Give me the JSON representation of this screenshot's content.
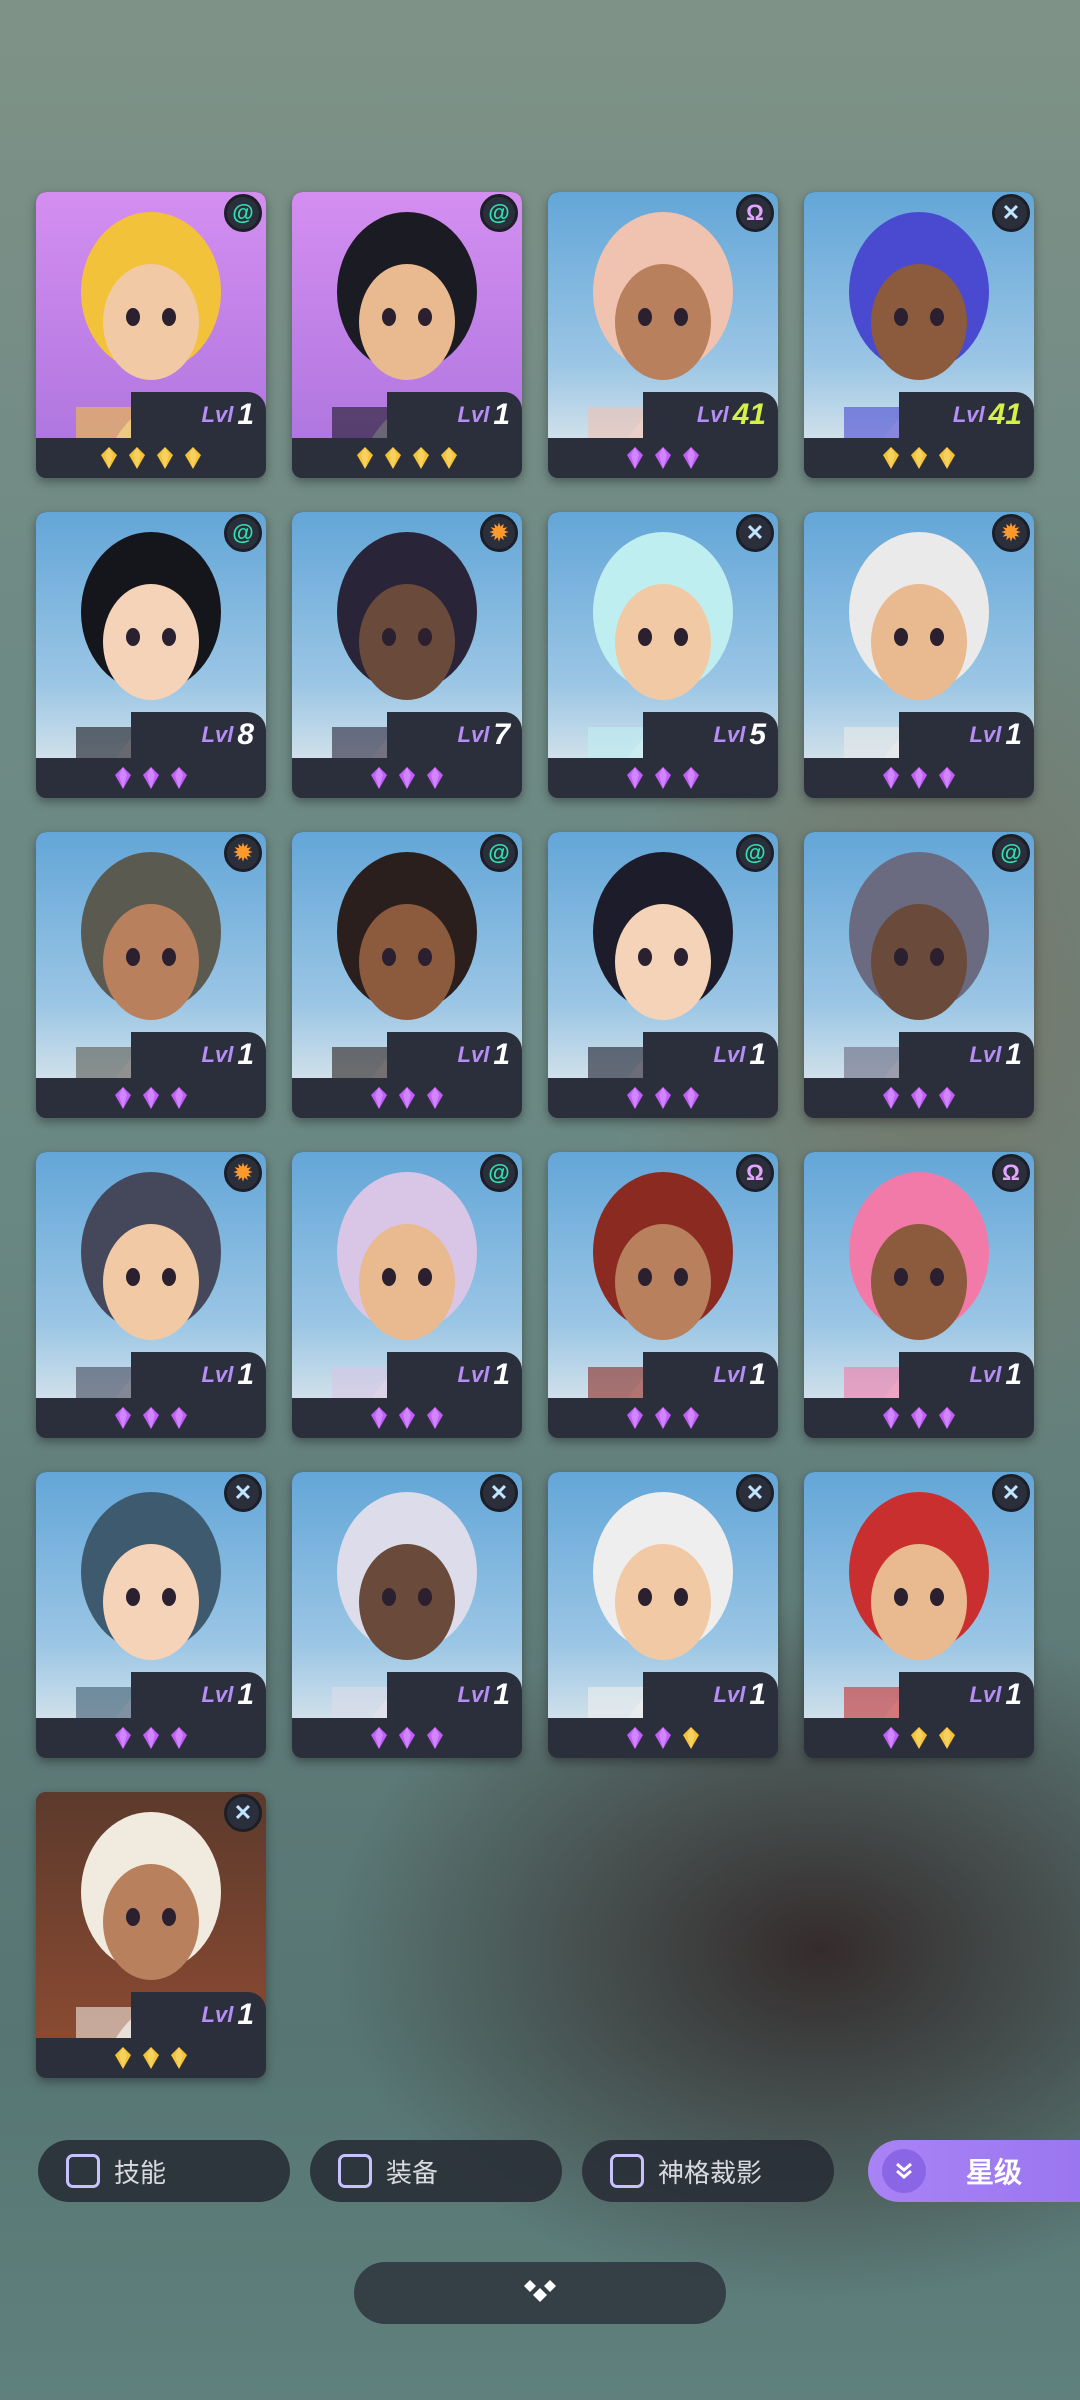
{
  "colors": {
    "gem_purple": "#c25cff",
    "gem_gold": "#f5c12e",
    "accent": "#a983f5",
    "level_label": "#b68ef5",
    "level_high": "#d6f04a"
  },
  "heroes": [
    {
      "bg": "purple",
      "class_icon": "spiral-icon",
      "lvl_label": "Lvl",
      "level": "1",
      "stars": [
        "gold",
        "gold",
        "gold",
        "gold"
      ]
    },
    {
      "bg": "purple",
      "class_icon": "spiral-icon",
      "lvl_label": "Lvl",
      "level": "1",
      "stars": [
        "gold",
        "gold",
        "gold",
        "gold"
      ]
    },
    {
      "bg": "blue",
      "class_icon": "omega-icon",
      "lvl_label": "Lvl",
      "level": "41",
      "stars": [
        "purple",
        "purple",
        "purple"
      ]
    },
    {
      "bg": "blue",
      "class_icon": "cross-icon",
      "lvl_label": "Lvl",
      "level": "41",
      "stars": [
        "gold",
        "gold",
        "gold"
      ]
    },
    {
      "bg": "blue",
      "class_icon": "spiral-icon",
      "lvl_label": "Lvl",
      "level": "8",
      "stars": [
        "purple",
        "purple",
        "purple"
      ]
    },
    {
      "bg": "blue",
      "class_icon": "sun-icon",
      "lvl_label": "Lvl",
      "level": "7",
      "stars": [
        "purple",
        "purple",
        "purple"
      ]
    },
    {
      "bg": "blue",
      "class_icon": "cross-icon",
      "lvl_label": "Lvl",
      "level": "5",
      "stars": [
        "purple",
        "purple",
        "purple"
      ]
    },
    {
      "bg": "blue",
      "class_icon": "sun-icon",
      "lvl_label": "Lvl",
      "level": "1",
      "stars": [
        "purple",
        "purple",
        "purple"
      ]
    },
    {
      "bg": "blue",
      "class_icon": "sun-icon",
      "lvl_label": "Lvl",
      "level": "1",
      "stars": [
        "purple",
        "purple",
        "purple"
      ]
    },
    {
      "bg": "blue",
      "class_icon": "spiral-icon",
      "lvl_label": "Lvl",
      "level": "1",
      "stars": [
        "purple",
        "purple",
        "purple"
      ]
    },
    {
      "bg": "blue",
      "class_icon": "spiral-icon",
      "lvl_label": "Lvl",
      "level": "1",
      "stars": [
        "purple",
        "purple",
        "purple"
      ]
    },
    {
      "bg": "blue",
      "class_icon": "spiral-icon",
      "lvl_label": "Lvl",
      "level": "1",
      "stars": [
        "purple",
        "purple",
        "purple"
      ]
    },
    {
      "bg": "blue",
      "class_icon": "sun-icon",
      "lvl_label": "Lvl",
      "level": "1",
      "stars": [
        "purple",
        "purple",
        "purple"
      ]
    },
    {
      "bg": "blue",
      "class_icon": "spiral-icon",
      "lvl_label": "Lvl",
      "level": "1",
      "stars": [
        "purple",
        "purple",
        "purple"
      ]
    },
    {
      "bg": "blue",
      "class_icon": "omega-icon",
      "lvl_label": "Lvl",
      "level": "1",
      "stars": [
        "purple",
        "purple",
        "purple"
      ]
    },
    {
      "bg": "blue",
      "class_icon": "omega-icon",
      "lvl_label": "Lvl",
      "level": "1",
      "stars": [
        "purple",
        "purple",
        "purple"
      ]
    },
    {
      "bg": "blue",
      "class_icon": "cross-icon",
      "lvl_label": "Lvl",
      "level": "1",
      "stars": [
        "purple",
        "purple",
        "purple"
      ]
    },
    {
      "bg": "blue",
      "class_icon": "cross-icon",
      "lvl_label": "Lvl",
      "level": "1",
      "stars": [
        "purple",
        "purple",
        "purple"
      ]
    },
    {
      "bg": "blue",
      "class_icon": "cross-icon",
      "lvl_label": "Lvl",
      "level": "1",
      "stars": [
        "purple",
        "purple",
        "gold"
      ]
    },
    {
      "bg": "blue",
      "class_icon": "cross-icon",
      "lvl_label": "Lvl",
      "level": "1",
      "stars": [
        "purple",
        "gold",
        "gold"
      ]
    },
    {
      "bg": "orange",
      "class_icon": "cross-icon",
      "lvl_label": "Lvl",
      "level": "1",
      "stars": [
        "gold",
        "gold",
        "gold"
      ]
    }
  ],
  "filters": {
    "skill": "技能",
    "equipment": "装备",
    "divinity": "神格裁影"
  },
  "sort": {
    "label": "星级",
    "icon": "double-chevron-down-icon"
  },
  "bottom_bar": {
    "icon": "diamond-cluster-icon"
  }
}
